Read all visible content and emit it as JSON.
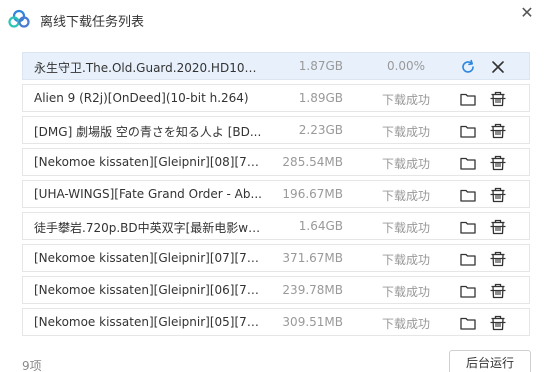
{
  "window": {
    "title": "离线下载任务列表",
    "close_glyph": "✕",
    "icon": "cloud-logo-icon"
  },
  "tasks": [
    {
      "name": "永生守卫.The.Old.Guard.2020.HD1080...",
      "size": "1.87GB",
      "status": "0.00%",
      "action1_icon": "refresh-icon",
      "action2_icon": "close-icon"
    },
    {
      "name": "Alien 9 (R2j)[OnDeed](10-bit h.264)",
      "size": "1.89GB",
      "status": "下载成功",
      "action1_icon": "folder-icon",
      "action2_icon": "trash-icon"
    },
    {
      "name": "[DMG] 劇場版 空の青さを知る人よ [BD...",
      "size": "2.23GB",
      "status": "下载成功",
      "action1_icon": "folder-icon",
      "action2_icon": "trash-icon"
    },
    {
      "name": "[Nekomoe kissaten][Gleipnir][08][720...",
      "size": "285.54MB",
      "status": "下载成功",
      "action1_icon": "folder-icon",
      "action2_icon": "trash-icon"
    },
    {
      "name": "[UHA-WINGS][Fate Grand Order - Ab...",
      "size": "196.67MB",
      "status": "下载成功",
      "action1_icon": "folder-icon",
      "action2_icon": "trash-icon"
    },
    {
      "name": "徒手攀岩.720p.BD中英双字[最新电影www...",
      "size": "1.64GB",
      "status": "下载成功",
      "action1_icon": "folder-icon",
      "action2_icon": "trash-icon"
    },
    {
      "name": "[Nekomoe kissaten][Gleipnir][07][720...",
      "size": "371.67MB",
      "status": "下载成功",
      "action1_icon": "folder-icon",
      "action2_icon": "trash-icon"
    },
    {
      "name": "[Nekomoe kissaten][Gleipnir][06][720...",
      "size": "239.78MB",
      "status": "下载成功",
      "action1_icon": "folder-icon",
      "action2_icon": "trash-icon"
    },
    {
      "name": "[Nekomoe kissaten][Gleipnir][05][720...",
      "size": "309.51MB",
      "status": "下载成功",
      "action1_icon": "folder-icon",
      "action2_icon": "trash-icon"
    }
  ],
  "footer": {
    "count": "9项",
    "background_button": "后台运行"
  },
  "colors": {
    "selected_row": "#e8f1fb",
    "refresh_icon": "#2e86de",
    "muted_text": "#999999"
  }
}
